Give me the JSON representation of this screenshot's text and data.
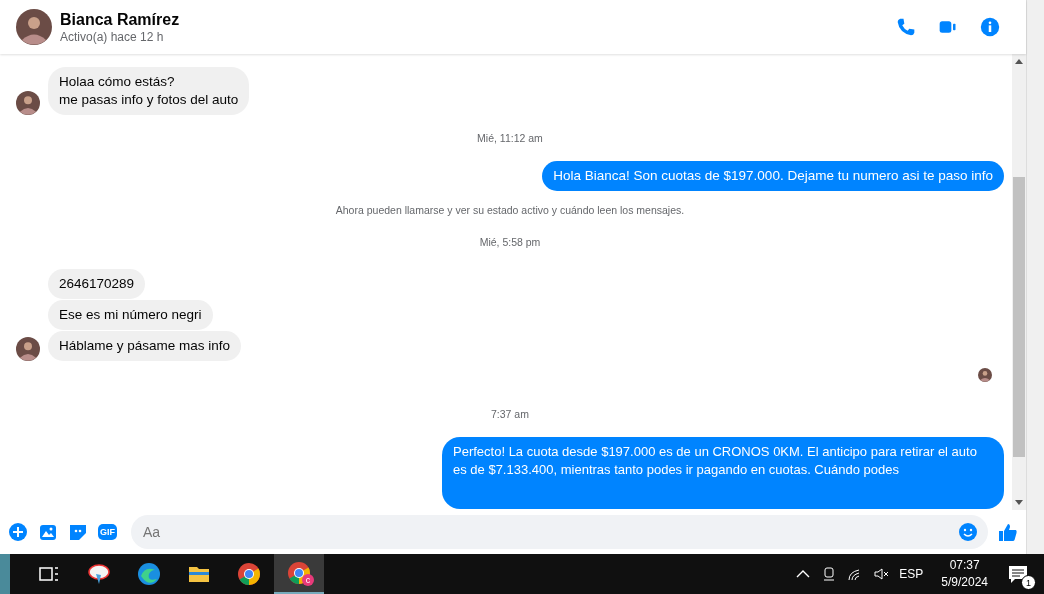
{
  "header": {
    "name": "Bianca Ramírez",
    "status": "Activo(a) hace 12 h"
  },
  "messages": [
    {
      "kind": "incoming",
      "bubbles": [
        "Holaa cómo estás?\nme pasas info y fotos del auto"
      ]
    },
    {
      "kind": "timestamp",
      "text": "Mié, 11:12 am"
    },
    {
      "kind": "outgoing",
      "bubbles": [
        "Hola Bianca! Son cuotas de $197.000. Dejame tu numero asi te paso info"
      ]
    },
    {
      "kind": "notice",
      "text": "Ahora pueden llamarse y ver su estado activo y cuándo leen los mensajes."
    },
    {
      "kind": "timestamp",
      "text": "Mié, 5:58 pm"
    },
    {
      "kind": "incoming",
      "bubbles": [
        "2646170289",
        "Ese es mi número negri",
        "Háblame y pásame mas info"
      ]
    },
    {
      "kind": "seen"
    },
    {
      "kind": "timestamp",
      "text": "7:37 am"
    },
    {
      "kind": "outgoing",
      "bubbles": [
        "Perfecto! La cuota desde $197.000 es de un CRONOS 0KM. El anticipo para retirar el auto es de $7.133.400, mientras tanto podes ir pagando en cuotas. Cuándo podes"
      ]
    }
  ],
  "composer": {
    "gif_label": "GIF",
    "placeholder": "Aa"
  },
  "taskbar": {
    "apps": [
      {
        "kind": "taskview",
        "selected": false
      },
      {
        "kind": "paint",
        "selected": false
      },
      {
        "kind": "edge",
        "selected": false
      },
      {
        "kind": "explorer",
        "selected": false
      },
      {
        "kind": "chrome",
        "selected": false
      },
      {
        "kind": "chrome-profile",
        "selected": true,
        "badge": "c"
      }
    ],
    "language": "ESP",
    "time": "07:37",
    "date": "5/9/2024",
    "notifications": "1"
  }
}
